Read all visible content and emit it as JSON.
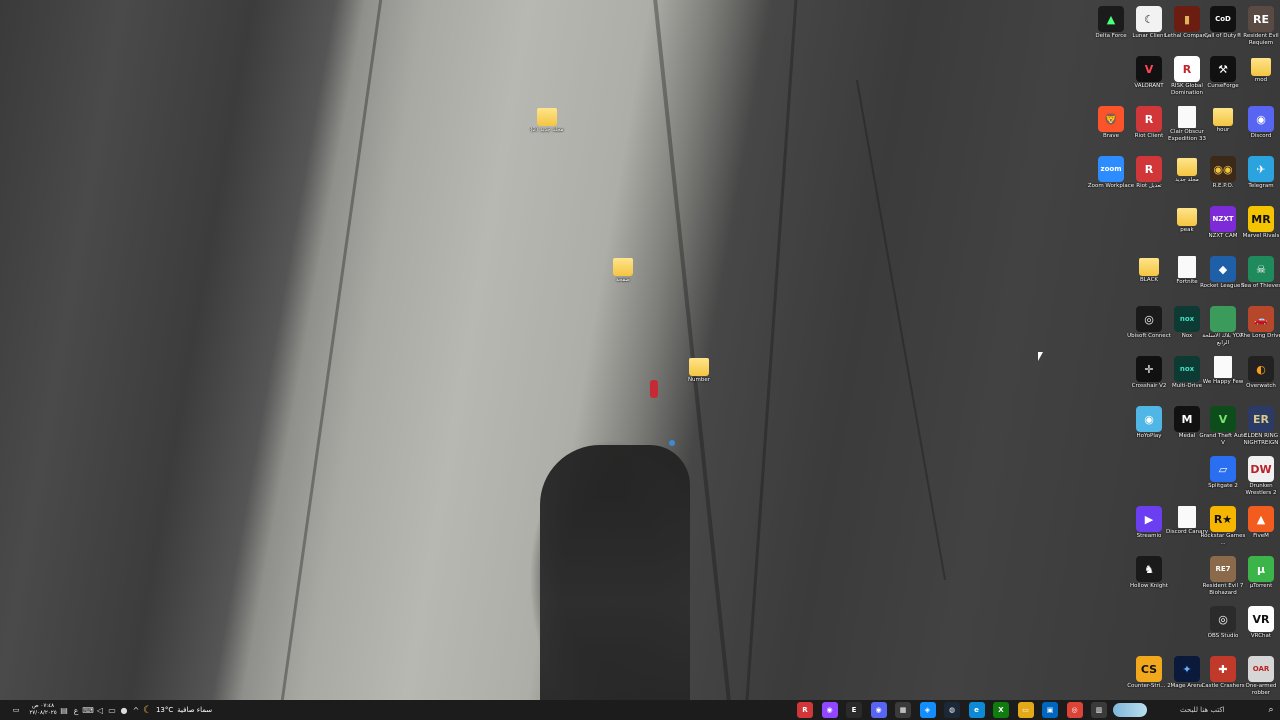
{
  "desktop": {
    "icons": [
      {
        "label": "Delta Force",
        "glyph": "▲",
        "color": "#1b1b1b",
        "fg": "#4cff7a",
        "kind": "app"
      },
      {
        "label": "Lunar Client",
        "glyph": "☾",
        "color": "#f2f2f2",
        "fg": "#222",
        "kind": "app"
      },
      {
        "label": "Lethal Company",
        "glyph": "▮",
        "color": "#6b1d12",
        "fg": "#e3b35a",
        "kind": "app"
      },
      {
        "label": "Call of Duty®",
        "glyph": "CoD",
        "color": "#111",
        "fg": "#fff",
        "kind": "app"
      },
      {
        "label": "Resident Evil Requiem",
        "glyph": "RE",
        "color": "#5a4a44",
        "fg": "#fff",
        "kind": "app"
      },
      {
        "label": "VALORANT",
        "glyph": "V",
        "color": "#111",
        "fg": "#ff4655",
        "kind": "app"
      },
      {
        "label": "RISK Global Domination",
        "glyph": "R",
        "color": "#fff",
        "fg": "#c0262e",
        "kind": "app"
      },
      {
        "label": "CurseForge",
        "glyph": "⚒",
        "color": "#111",
        "fg": "#fff",
        "kind": "app"
      },
      {
        "label": "mod",
        "glyph": "",
        "color": "",
        "fg": "",
        "kind": "folder"
      },
      {
        "label": "(2) مجلد جديد",
        "glyph": "",
        "color": "",
        "fg": "",
        "kind": "folder"
      },
      {
        "label": "Brave",
        "glyph": "🦁",
        "color": "#fb542b",
        "fg": "#fff",
        "kind": "app"
      },
      {
        "label": "Riot Client",
        "glyph": "R",
        "color": "#d13639",
        "fg": "#fff",
        "kind": "app"
      },
      {
        "label": "Clair Obscur Expedition 33",
        "glyph": "",
        "color": "",
        "fg": "",
        "kind": "doc"
      },
      {
        "label": "hour",
        "glyph": "",
        "color": "",
        "fg": "",
        "kind": "folder"
      },
      {
        "label": "Discord",
        "glyph": "◉",
        "color": "#5865f2",
        "fg": "#fff",
        "kind": "app"
      },
      {
        "label": "Zoom Workplace",
        "glyph": "zoom",
        "color": "#2d8cff",
        "fg": "#fff",
        "kind": "app"
      },
      {
        "label": "Riot تعديل",
        "glyph": "R",
        "color": "#d13639",
        "fg": "#fff",
        "kind": "app"
      },
      {
        "label": "مجلد جديد",
        "glyph": "",
        "color": "",
        "fg": "",
        "kind": "folder"
      },
      {
        "label": "R.E.P.O.",
        "glyph": "◉◉",
        "color": "#3b2a1a",
        "fg": "#f5c542",
        "kind": "app"
      },
      {
        "label": "Telegram",
        "glyph": "✈",
        "color": "#2aa3df",
        "fg": "#fff",
        "kind": "app"
      },
      {
        "label": "peak",
        "glyph": "",
        "color": "",
        "fg": "",
        "kind": "folder"
      },
      {
        "label": "NZXT CAM",
        "glyph": "NZXT",
        "color": "#7d2bd9",
        "fg": "#fff",
        "kind": "app"
      },
      {
        "label": "Marvel Rivals",
        "glyph": "MR",
        "color": "#f5c400",
        "fg": "#111",
        "kind": "app"
      },
      {
        "label": "BLACK",
        "glyph": "",
        "color": "",
        "fg": "",
        "kind": "folder"
      },
      {
        "label": "Fortnite",
        "glyph": "",
        "color": "",
        "fg": "",
        "kind": "doc"
      },
      {
        "label": "Rocket League®",
        "glyph": "◆",
        "color": "#1f5fa8",
        "fg": "#fff",
        "kind": "app"
      },
      {
        "label": "Sea of Thieves",
        "glyph": "☠",
        "color": "#1f8a5c",
        "fg": "#fff",
        "kind": "app"
      },
      {
        "label": "Ubisoft Connect",
        "glyph": "◎",
        "color": "#1a1a1a",
        "fg": "#fff",
        "kind": "app"
      },
      {
        "label": "Nox",
        "glyph": "nox",
        "color": "#0e3a34",
        "fg": "#3fe0c5",
        "kind": "app"
      },
      {
        "label": "بلاك الأسلحة YOA الرابع",
        "glyph": "",
        "color": "#3a9b5a",
        "fg": "#fff",
        "kind": "app"
      },
      {
        "label": "The Long Drive",
        "glyph": "🚗",
        "color": "#b7472a",
        "fg": "#fff",
        "kind": "app"
      },
      {
        "label": "Crosshair V2",
        "glyph": "✛",
        "color": "#111",
        "fg": "#fff",
        "kind": "app"
      },
      {
        "label": "Multi-Drive",
        "glyph": "nox",
        "color": "#0e3a34",
        "fg": "#3fe0c5",
        "kind": "app"
      },
      {
        "label": "We Happy Few",
        "glyph": "",
        "color": "",
        "fg": "",
        "kind": "doc"
      },
      {
        "label": "Overwatch",
        "glyph": "◐",
        "color": "#222",
        "fg": "#f99e1a",
        "kind": "app"
      },
      {
        "label": "HoYoPlay",
        "glyph": "◉",
        "color": "#4fb6e6",
        "fg": "#fff",
        "kind": "app"
      },
      {
        "label": "Medal",
        "glyph": "M",
        "color": "#111",
        "fg": "#fff",
        "kind": "app"
      },
      {
        "label": "Grand Theft Auto V",
        "glyph": "V",
        "color": "#0d4d1b",
        "fg": "#7ae36b",
        "kind": "app"
      },
      {
        "label": "ELDEN RING NIGHTREIGN",
        "glyph": "ER",
        "color": "#2c3a66",
        "fg": "#d9c98a",
        "kind": "app"
      },
      {
        "label": "Splitgate 2",
        "glyph": "▱",
        "color": "#2a6ff2",
        "fg": "#fff",
        "kind": "app"
      },
      {
        "label": "Drunken Wrestlers 2",
        "glyph": "DW",
        "color": "#f1f1f1",
        "fg": "#b8202a",
        "kind": "app"
      },
      {
        "label": "Streamio",
        "glyph": "▶",
        "color": "#6b3ef2",
        "fg": "#fff",
        "kind": "app"
      },
      {
        "label": "Discord Canary",
        "glyph": "",
        "color": "",
        "fg": "",
        "kind": "doc"
      },
      {
        "label": "Rockstar Games ...",
        "glyph": "R★",
        "color": "#f6b500",
        "fg": "#111",
        "kind": "app"
      },
      {
        "label": "FiveM",
        "glyph": "▲",
        "color": "#f25c1e",
        "fg": "#fff",
        "kind": "app"
      },
      {
        "label": "Hollow Knight",
        "glyph": "♞",
        "color": "#1a1a1a",
        "fg": "#fff",
        "kind": "app"
      },
      {
        "label": "Resident Evil 7 Biohazard",
        "glyph": "RE7",
        "color": "#8a6a4a",
        "fg": "#fff",
        "kind": "app"
      },
      {
        "label": "µTorrent",
        "glyph": "µ",
        "color": "#3bb54a",
        "fg": "#fff",
        "kind": "app"
      },
      {
        "label": "OBS Studio",
        "glyph": "◎",
        "color": "#2b2b2b",
        "fg": "#fff",
        "kind": "app"
      },
      {
        "label": "VRChat",
        "glyph": "VR",
        "color": "#fff",
        "fg": "#111",
        "kind": "app"
      },
      {
        "label": "Counter-Stri... 2",
        "glyph": "CS",
        "color": "#f2a81d",
        "fg": "#111",
        "kind": "app"
      },
      {
        "label": "Mage Arena",
        "glyph": "✦",
        "color": "#0b1a3a",
        "fg": "#6bb0ff",
        "kind": "app"
      },
      {
        "label": "Castle Crashers",
        "glyph": "✚",
        "color": "#c0392b",
        "fg": "#fff",
        "kind": "app"
      },
      {
        "label": "One-armed robber",
        "glyph": "OAR",
        "color": "#d6d6d6",
        "fg": "#b22",
        "kind": "app"
      },
      {
        "label": "صفحة",
        "glyph": "",
        "color": "",
        "fg": "",
        "kind": "folder"
      },
      {
        "label": "Number",
        "glyph": "",
        "color": "",
        "fg": "",
        "kind": "folder"
      }
    ]
  },
  "taskbar": {
    "time": "٠٧:٤٨ ص",
    "date": "٢٧/٠٨/٢٠٢٥",
    "weather_temp": "13°C",
    "weather_text": "سماء صافية",
    "search_placeholder": "اكتب هنا للبحث",
    "tray_icons": [
      "notification-icon",
      "ime-icon",
      "keyboard-icon",
      "volume-icon",
      "network-icon",
      "mic-icon",
      "chevron-up-icon"
    ],
    "pinned_apps": [
      {
        "name": "riot-app",
        "glyph": "R",
        "color": "#d13639"
      },
      {
        "name": "twitch-app",
        "glyph": "◉",
        "color": "#9147ff"
      },
      {
        "name": "epic-app",
        "glyph": "E",
        "color": "#2a2a2a"
      },
      {
        "name": "discord-app",
        "glyph": "◉",
        "color": "#5865f2"
      },
      {
        "name": "calculator-app",
        "glyph": "▦",
        "color": "#3a3a3a"
      },
      {
        "name": "battlenet-app",
        "glyph": "◈",
        "color": "#148eff"
      },
      {
        "name": "steam-app",
        "glyph": "◍",
        "color": "#1b2838"
      },
      {
        "name": "edge-app",
        "glyph": "e",
        "color": "#0c8ad6"
      },
      {
        "name": "xbox-app",
        "glyph": "X",
        "color": "#107c10"
      },
      {
        "name": "file-explorer-app",
        "glyph": "▭",
        "color": "#e3a919"
      },
      {
        "name": "store-app",
        "glyph": "▣",
        "color": "#0067c0"
      },
      {
        "name": "chrome-app",
        "glyph": "◎",
        "color": "#db4437"
      },
      {
        "name": "task-view-app",
        "glyph": "▥",
        "color": "#3a3a3a"
      }
    ]
  }
}
